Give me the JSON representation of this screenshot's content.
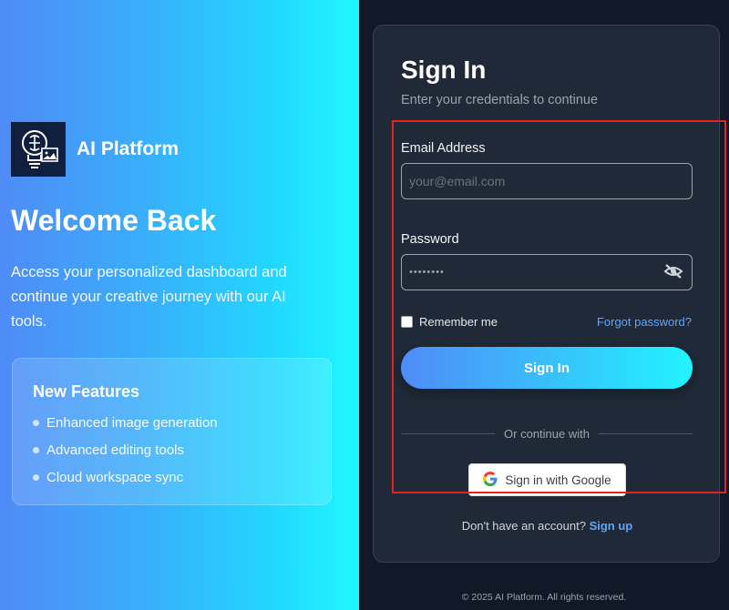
{
  "brand": {
    "name": "AI Platform"
  },
  "hero": {
    "heading": "Welcome Back",
    "description": "Access your personalized dashboard and continue your creative journey with our AI tools."
  },
  "features": {
    "title": "New Features",
    "items": [
      "Enhanced image generation",
      "Advanced editing tools",
      "Cloud workspace sync"
    ]
  },
  "signin": {
    "title": "Sign In",
    "subtitle": "Enter your credentials to continue",
    "email_label": "Email Address",
    "email_placeholder": "your@email.com",
    "password_label": "Password",
    "password_value": "••••••••",
    "remember_label": "Remember me",
    "forgot_label": "Forgot password?",
    "submit_label": "Sign In",
    "divider_text": "Or continue with",
    "google_label": "Sign in with Google",
    "signup_prompt": "Don't have an account?",
    "signup_link": "Sign up"
  },
  "footer": {
    "text": "© 2025 AI Platform. All rights reserved."
  },
  "icons": {
    "logo": "lightbulb-brain-icon",
    "eye": "eye-slash-icon",
    "google": "google-g-icon"
  },
  "colors": {
    "accent_start": "#4f8bf7",
    "accent_end": "#22f3ff",
    "link": "#60a5fa",
    "panel": "#1f2937",
    "background": "#111827",
    "highlight": "#e02424"
  }
}
